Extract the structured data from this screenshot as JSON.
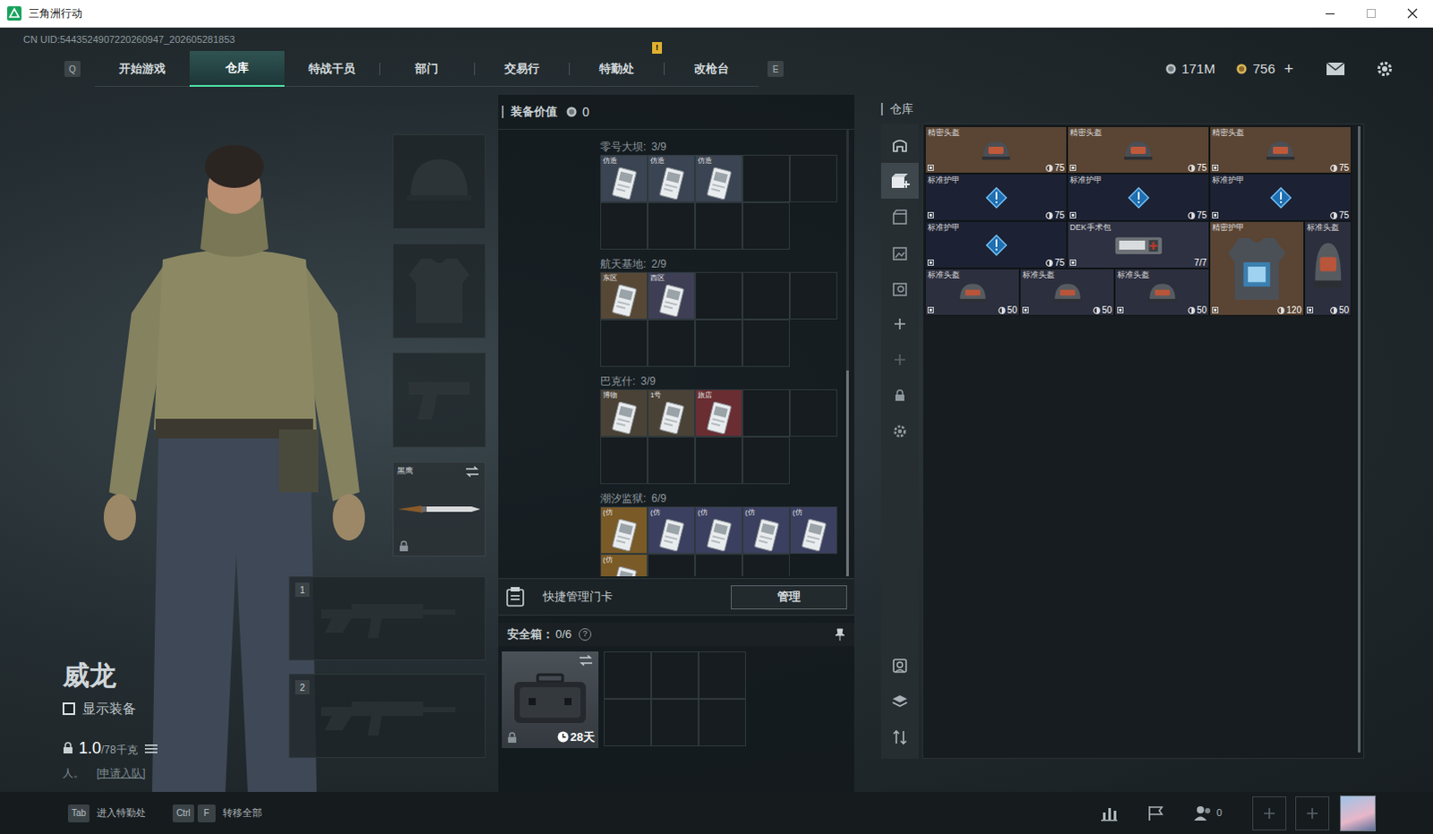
{
  "window": {
    "title": "三角洲行动"
  },
  "uid": "CN UID:5443524907220260947_202605281853",
  "nav": {
    "prev_key": "Q",
    "next_key": "E",
    "tabs": [
      {
        "label": "开始游戏",
        "selected": false
      },
      {
        "label": "仓库",
        "selected": true
      },
      {
        "label": "特战干员",
        "selected": false
      },
      {
        "label": "部门",
        "selected": false
      },
      {
        "label": "交易行",
        "selected": false
      },
      {
        "label": "特勤处",
        "selected": false,
        "badge": "!"
      },
      {
        "label": "改枪台",
        "selected": false
      }
    ]
  },
  "currency": [
    {
      "kind": "silver",
      "amount": "171M"
    },
    {
      "kind": "gold",
      "amount": "756"
    }
  ],
  "currency_add": "+",
  "character": {
    "name": "威龙",
    "show_gear": {
      "label": "显示装备",
      "checked": false
    },
    "weight": "1.0",
    "weight_max": "/78千克",
    "status": "人。",
    "invite": "[申请入队]"
  },
  "equipment": {
    "slots": [
      {
        "kind": "helmet",
        "locked": false
      },
      {
        "kind": "armor",
        "locked": false
      },
      {
        "kind": "pistol",
        "locked": false
      },
      {
        "kind": "melee",
        "label": "黑鹰",
        "locked": true
      }
    ],
    "weapons": [
      {
        "slot": "1"
      },
      {
        "slot": "2"
      }
    ]
  },
  "loadout": {
    "value_label": "装备价值",
    "value": "0",
    "key_sections": [
      {
        "map": "零号大坝:",
        "count": "3/9",
        "cards": [
          {
            "label": "仿造",
            "color": "#3b4452"
          },
          {
            "label": "仿造",
            "color": "#3b4452"
          },
          {
            "label": "仿造",
            "color": "#3b4452"
          }
        ]
      },
      {
        "map": "航天基地:",
        "count": "2/9",
        "cards": [
          {
            "label": "东区",
            "color": "#574836"
          },
          {
            "label": "西区",
            "color": "#3e3f55"
          }
        ]
      },
      {
        "map": "巴克什:",
        "count": "3/9",
        "cards": [
          {
            "label": "博物",
            "color": "#4a4236"
          },
          {
            "label": "1号",
            "color": "#4a4236"
          },
          {
            "label": "旅店",
            "color": "#6a2e32"
          }
        ]
      },
      {
        "map": "潮汐监狱:",
        "count": "6/9",
        "cards": [
          {
            "label": "(仿",
            "color": "#7a5a26"
          },
          {
            "label": "(仿",
            "color": "#3b4060"
          },
          {
            "label": "(仿",
            "color": "#3b4060"
          },
          {
            "label": "(仿",
            "color": "#3b4060"
          },
          {
            "label": "(仿",
            "color": "#3b4060"
          },
          {
            "label": "(仿",
            "color": "#7a5a26"
          }
        ]
      }
    ],
    "quick_manage": {
      "label": "快捷管理门卡",
      "button": "管理"
    },
    "safe_box": {
      "label": "安全箱：",
      "count": "0/6",
      "help": "?",
      "timer": "28天",
      "locked": true
    }
  },
  "warehouse": {
    "title": "仓库",
    "tools": [
      {
        "kind": "home",
        "selected": false,
        "disabled": false
      },
      {
        "kind": "box-add",
        "selected": true,
        "disabled": false
      },
      {
        "kind": "box",
        "selected": false,
        "disabled": false
      },
      {
        "kind": "box-image",
        "selected": false,
        "disabled": false
      },
      {
        "kind": "box-search",
        "selected": false,
        "disabled": false
      },
      {
        "kind": "plus",
        "selected": false,
        "disabled": false
      },
      {
        "kind": "plus",
        "selected": false,
        "disabled": true
      },
      {
        "kind": "lock",
        "selected": false,
        "disabled": false
      },
      {
        "kind": "gear",
        "selected": false,
        "disabled": false
      }
    ],
    "bottom_tools": [
      {
        "kind": "photo",
        "selected": false,
        "disabled": false
      },
      {
        "kind": "layers",
        "selected": false,
        "disabled": false
      },
      {
        "kind": "sort",
        "selected": false,
        "disabled": false
      }
    ],
    "items": [
      {
        "name": "精密头盔",
        "value": "75",
        "kind": "helmet-precision",
        "color": "#5a4433"
      },
      {
        "name": "精密头盔",
        "value": "75",
        "kind": "helmet-precision",
        "color": "#5a4433"
      },
      {
        "name": "精密头盔",
        "value": "75",
        "kind": "helmet-precision",
        "color": "#5a4433"
      },
      {
        "name": "标准护甲",
        "value": "75",
        "kind": "armor-standard",
        "color": "#1c2233"
      },
      {
        "name": "标准护甲",
        "value": "75",
        "kind": "armor-standard",
        "color": "#1c2233"
      },
      {
        "name": "标准护甲",
        "value": "75",
        "kind": "armor-standard",
        "color": "#1c2233"
      },
      {
        "name": "标准护甲",
        "value": "75",
        "kind": "armor-standard",
        "color": "#1c2233"
      },
      {
        "name": "DEK手术包",
        "value": "7/7",
        "kind": "medkit",
        "color": "#2e3142"
      },
      {
        "name": "精密护甲",
        "value": "120",
        "kind": "armor-precision",
        "color": "#5a4433"
      },
      {
        "name": "标准头盔",
        "value": "50",
        "kind": "helmet-tall",
        "color": "#2c2f3e"
      },
      {
        "name": "标准头盔",
        "value": "50",
        "kind": "helmet-standard",
        "color": "#2c2f3e"
      },
      {
        "name": "标准头盔",
        "value": "50",
        "kind": "helmet-standard",
        "color": "#2c2f3e"
      },
      {
        "name": "标准头盔",
        "value": "50",
        "kind": "helmet-standard",
        "color": "#2c2f3e"
      }
    ]
  },
  "bottom_bar": {
    "shortcuts": [
      {
        "keys": [
          "Tab"
        ],
        "label": "进入特勤处"
      },
      {
        "keys": [
          "Ctrl",
          "F"
        ],
        "label": "转移全部"
      }
    ],
    "friends_count": "0"
  }
}
